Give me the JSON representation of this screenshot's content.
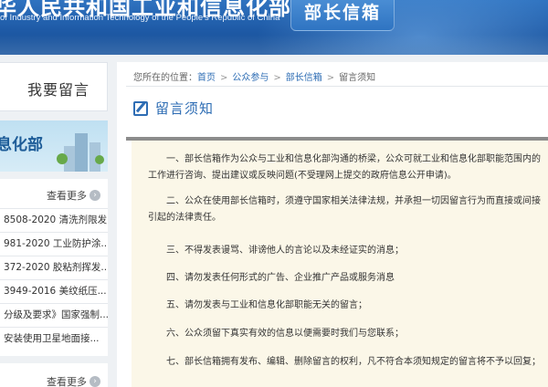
{
  "header": {
    "ministry_cn": "华人民共和国工业和信息化部",
    "ministry_en": "of Industry and Information Technology of the People's Republic of China",
    "mailbox_tab": "部长信箱"
  },
  "sidebar": {
    "message_box_label": "我要留言",
    "promo_text": "息化部",
    "more_label": "查看更多",
    "items": [
      "8508-2020 清洗剂限发...",
      "981-2020 工业防护涂...",
      "372-2020 胶粘剂挥发...",
      "3949-2016 美纹纸压...",
      "分级及要求》国家强制...",
      "安装使用卫星地面接..."
    ],
    "more_label_2": "查看更多"
  },
  "main": {
    "breadcrumb": {
      "prefix": "您所在的位置：",
      "items": [
        "首页",
        "公众参与",
        "部长信箱",
        "留言须知"
      ],
      "separator": ">"
    },
    "title": "留言须知",
    "paragraphs": [
      "一、部长信箱作为公众与工业和信息化部沟通的桥梁，公众可就工业和信息化部职能范围内的工作进行咨询、提出建议或反映问题(不受理网上提交的政府信息公开申请)。",
      "二、公众在使用部长信箱时，须遵守国家相关法律法规，并承担一切因留言行为而直接或间接引起的法律责任。",
      "三、不得发表谩骂、诽谤他人的言论以及未经证实的消息；",
      "四、请勿发表任何形式的广告、企业推广产品或服务消息",
      "五、请勿发表与工业和信息化部职能无关的留言；",
      "六、公众须留下真实有效的信息以便需要时我们与您联系；",
      "七、部长信箱拥有发布、编辑、删除留言的权利，凡不符合本须知规定的留言将不予以回复；"
    ]
  },
  "colors": {
    "header_blue": "#1e5aa6",
    "link_blue": "#2e6db4",
    "notice_bg": "#fbf7e8"
  },
  "icons": [
    "pen-edit-icon",
    "chevron-right-icon"
  ]
}
